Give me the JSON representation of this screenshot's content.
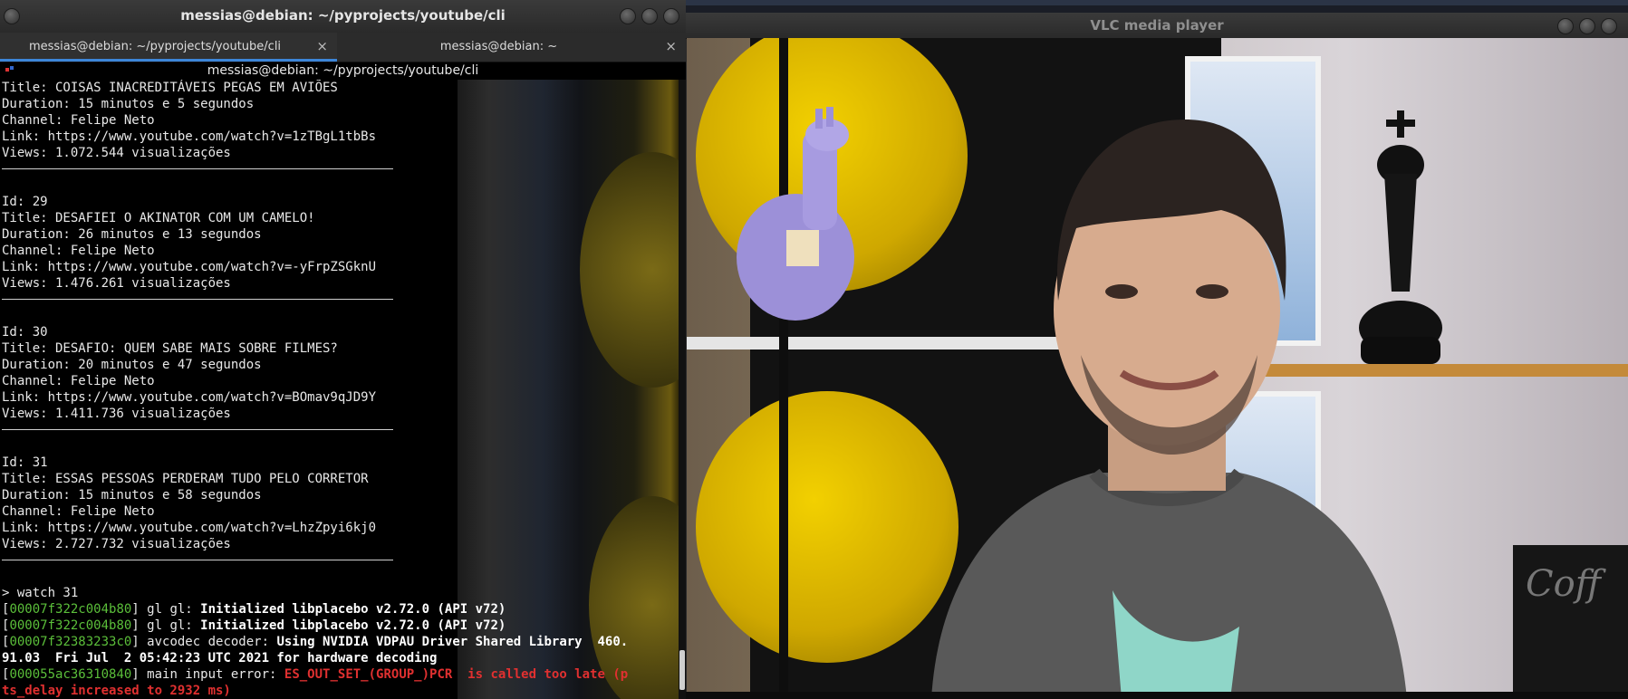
{
  "terminal": {
    "window_title": "messias@debian: ~/pyprojects/youtube/cli",
    "tabs": [
      {
        "label": "messias@debian: ~/pyprojects/youtube/cli",
        "close": "×"
      },
      {
        "label": "messias@debian: ~",
        "close": "×"
      }
    ],
    "subtitle": "messias@debian: ~/pyprojects/youtube/cli",
    "top_entry": {
      "title": "Title: COISAS INACREDITÁVEIS PEGAS EM AVIÕES",
      "duration": "Duration: 15 minutos e 5 segundos",
      "channel": "Channel: Felipe Neto",
      "link": "Link: https://www.youtube.com/watch?v=1zTBgL1tbBs",
      "views": "Views: 1.072.544 visualizações"
    },
    "entries": [
      {
        "id": "Id: 29",
        "title": "Title: DESAFIEI O AKINATOR COM UM CAMELO!",
        "duration": "Duration: 26 minutos e 13 segundos",
        "channel": "Channel: Felipe Neto",
        "link": "Link: https://www.youtube.com/watch?v=-yFrpZSGknU",
        "views": "Views: 1.476.261 visualizações"
      },
      {
        "id": "Id: 30",
        "title": "Title: DESAFIO: QUEM SABE MAIS SOBRE FILMES?",
        "duration": "Duration: 20 minutos e 47 segundos",
        "channel": "Channel: Felipe Neto",
        "link": "Link: https://www.youtube.com/watch?v=BOmav9qJD9Y",
        "views": "Views: 1.411.736 visualizações"
      },
      {
        "id": "Id: 31",
        "title": "Title: ESSAS PESSOAS PERDERAM TUDO PELO CORRETOR",
        "duration": "Duration: 15 minutos e 58 segundos",
        "channel": "Channel: Felipe Neto",
        "link": "Link: https://www.youtube.com/watch?v=LhzZpyi6kj0",
        "views": "Views: 2.727.732 visualizações"
      }
    ],
    "command": "> watch 31",
    "log": [
      {
        "addr": "00007f322c004b80",
        "module": "gl gl:",
        "msg": "Initialized libplacebo v2.72.0 (API v72)"
      },
      {
        "addr": "00007f322c004b80",
        "module": "gl gl:",
        "msg": "Initialized libplacebo v2.72.0 (API v72)"
      },
      {
        "addr": "00007f32383233c0",
        "module": "avcodec decoder:",
        "msg": "Using NVIDIA VDPAU Driver Shared Library  460."
      }
    ],
    "log_continuation": "91.03  Fri Jul  2 05:42:23 UTC 2021 for hardware decoding",
    "error": {
      "addr": "000055ac36310840",
      "module": "main input error:",
      "msg": "ES_OUT_SET_(GROUP_)PCR  is called too late (p",
      "continuation": "ts_delay increased to 2932 ms)"
    }
  },
  "vlc": {
    "window_title": "VLC media player",
    "sign_text": "Coff"
  }
}
